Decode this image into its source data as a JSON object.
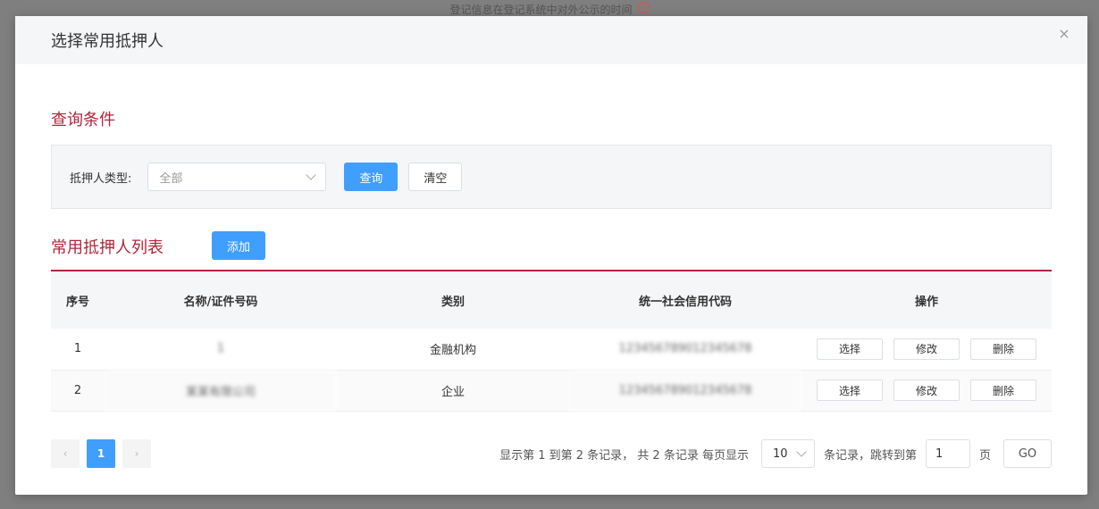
{
  "background_hint": "登记信息在登记系统中对外公示的时间",
  "dialog": {
    "title": "选择常用抵押人",
    "close_glyph": "×"
  },
  "query": {
    "section_title": "查询条件",
    "type_label": "抵押人类型:",
    "type_value": "全部",
    "query_button": "查询",
    "clear_button": "清空"
  },
  "list": {
    "section_title": "常用抵押人列表",
    "add_button": "添加",
    "columns": [
      "序号",
      "名称/证件号码",
      "类别",
      "统一社会信用代码",
      "操作"
    ],
    "rows": [
      {
        "index": "1",
        "name": "1",
        "category": "金融机构",
        "credit_code": "1234567890123456​78",
        "actions": [
          "选择",
          "修改",
          "删除"
        ]
      },
      {
        "index": "2",
        "name": "某某有限公司",
        "category": "企业",
        "credit_code": "1234567890123456​78",
        "actions": [
          "选择",
          "修改",
          "删除"
        ]
      }
    ]
  },
  "pagination": {
    "prev": "‹",
    "current_page": "1",
    "next": "›",
    "summary": "显示第 1 到第 2 条记录， 共 2 条记录 每页显示",
    "page_size": "10",
    "suffix": "条记录，跳转到第",
    "jump_value": "1",
    "page_unit": "页",
    "go_button": "GO"
  },
  "colors": {
    "accent": "#b0253b",
    "primary": "#409eff"
  }
}
